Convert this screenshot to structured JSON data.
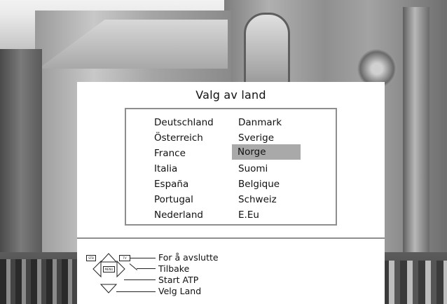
{
  "background": {
    "description_icon": "building-photo"
  },
  "dialog": {
    "title": "Valg av land",
    "countries_left": [
      "Deutschland",
      "Österreich",
      "France",
      "Italia",
      "España",
      "Portugal",
      "Nederland"
    ],
    "countries_right": [
      "Danmark",
      "Sverige",
      "Norge",
      "Suomi",
      "Belgique",
      "Schweiz",
      "E.Eu"
    ],
    "selected": "Norge"
  },
  "legend": {
    "keys": {
      "stb": "STB",
      "tv": "TV",
      "menu": "MENU"
    },
    "items": [
      "For å avslutte",
      "Tilbake",
      "Start ATP",
      "Velg Land"
    ]
  },
  "colors": {
    "panel": "#ffffff",
    "highlight": "#a9a9a9",
    "border": "#8e8e8e"
  }
}
